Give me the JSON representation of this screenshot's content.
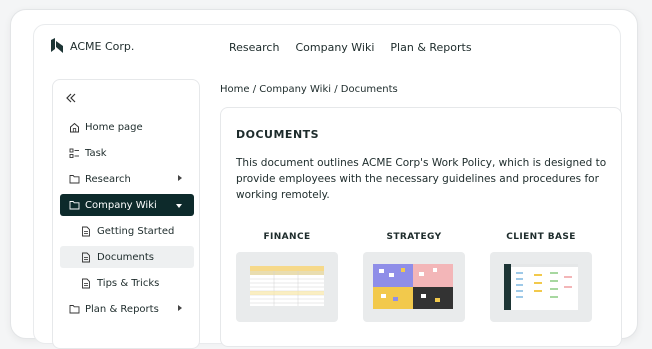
{
  "header": {
    "brand": "ACME Corp.",
    "nav": [
      "Research",
      "Company Wiki",
      "Plan & Reports"
    ]
  },
  "sidebar": {
    "collapse_icon": "double-chevron-left-icon",
    "items": [
      {
        "label": "Home page",
        "icon": "home-icon"
      },
      {
        "label": "Task",
        "icon": "checklist-icon"
      },
      {
        "label": "Research",
        "icon": "folder-icon"
      },
      {
        "label": "Company Wiki",
        "icon": "folder-icon"
      },
      {
        "label": "Getting Started",
        "icon": "document-icon"
      },
      {
        "label": "Documents",
        "icon": "document-icon"
      },
      {
        "label": "Tips & Tricks",
        "icon": "document-icon"
      },
      {
        "label": "Plan & Reports",
        "icon": "folder-icon"
      }
    ]
  },
  "breadcrumb": "Home / Company Wiki / Documents",
  "main": {
    "title": "DOCUMENTS",
    "description": "This document outlines ACME Corp's Work Policy, which is designed to provide employees with the necessary guidelines and procedures for working remotely.",
    "cards": [
      {
        "label": "FINANCE"
      },
      {
        "label": "STRATEGY"
      },
      {
        "label": "CLIENT BASE"
      }
    ]
  },
  "colors": {
    "accent_dark": "#0d2a2b",
    "selected_bg": "#eef0f1"
  }
}
